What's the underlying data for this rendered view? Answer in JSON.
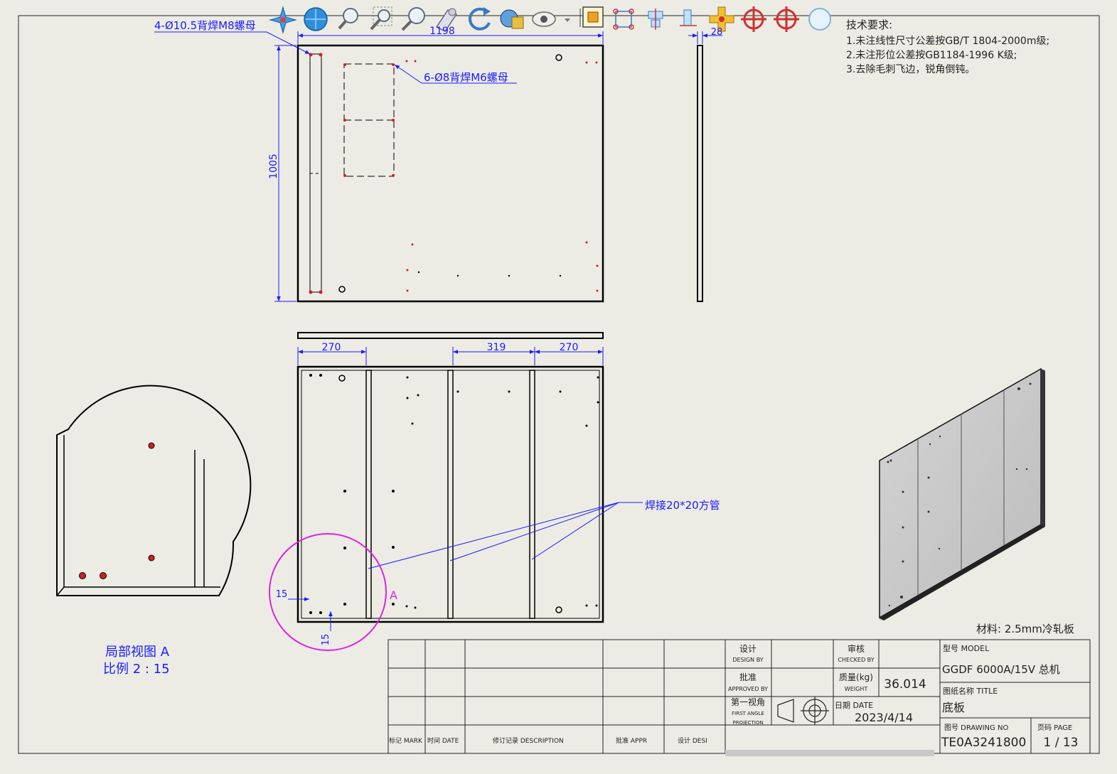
{
  "toolbar": {
    "icons": [
      "view-orientation-icon",
      "display-style-icon",
      "zoom-to-fit-icon",
      "zoom-to-area-icon",
      "zoom-in-out-icon",
      "rotate-view-icon",
      "refresh-icon",
      "apply-scene-icon",
      "hide-show-icon",
      "edit-appearance-icon",
      "select-bounding-icon",
      "align-horizontal-icon",
      "align-vertical-icon",
      "add-point-icon",
      "center-mark-icon",
      "center-mark-alt-icon",
      "circle-tool-icon"
    ]
  },
  "drawing": {
    "callouts": {
      "m8_nut": "4-Ø10.5背焊M8螺母",
      "m6_nut": "6-Ø8背焊M6螺母",
      "weld_tube": "焊接20*20方管",
      "detail_letter": "A"
    },
    "dims": {
      "width": "1198",
      "height": "1005",
      "thickness": "28",
      "seg_left": "270",
      "seg_mid": "319",
      "seg_right": "270",
      "offset_x": "15",
      "offset_y": "15"
    },
    "detail_view": {
      "title": "局部视图 A",
      "scale": "比例 2 : 15"
    },
    "tech_requirements": {
      "heading": "技术要求:",
      "items": [
        "1.未注线性尺寸公差按GB/T 1804-2000m级;",
        "2.未注形位公差按GB1184-1996 K级;",
        "3.去除毛刺飞边，锐角倒钝。"
      ]
    },
    "material": "材料: 2.5mm冷轧板"
  },
  "title_block": {
    "rev_headers": {
      "mark": "标记 MARK",
      "date": "时间 DATE",
      "description": "修订记录 DESCRIPTION",
      "appr": "批准 APPR",
      "desi": "设计 DESI"
    },
    "design_by_cn": "设计",
    "design_by_en": "DESIGN BY",
    "checked_by_cn": "审核",
    "checked_by_en": "CHECKED BY",
    "approved_by_cn": "批准",
    "approved_by_en": "APPROVED BY",
    "weight_label_cn": "质量(kg)",
    "weight_label_en": "WEIGHT",
    "weight_value": "36.014",
    "projection_cn": "第一视角",
    "projection_en1": "FIRST ANGLE",
    "projection_en2": "PROJECTION",
    "date_label": "日期 DATE",
    "date_value": "2023/4/14",
    "model_label": "型号 MODEL",
    "model_value": "GGDF 6000A/15V 总机",
    "title_label": "图纸名称 TITLE",
    "title_value": "底板",
    "drawing_no_label": "图号 DRAWING NO",
    "drawing_no_value": "TE0A3241800",
    "page_label": "页码 PAGE",
    "page_value": "1 / 13"
  },
  "colors": {
    "background": "#ecece4",
    "line": "#000000",
    "dimension_blue": "#1a1aff",
    "detail_circle": "#e020e0",
    "hole_red": "#cc0000"
  }
}
